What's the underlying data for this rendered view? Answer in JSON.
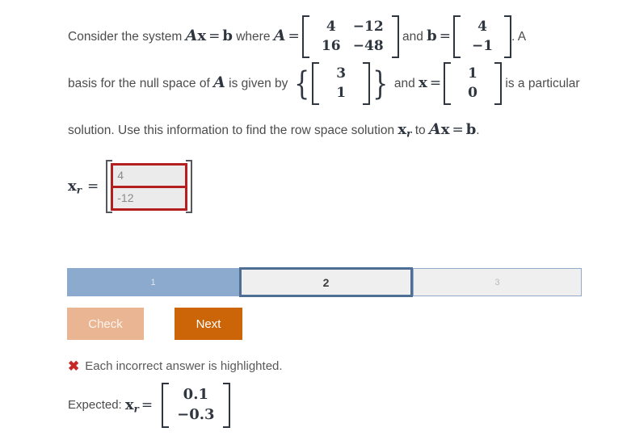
{
  "problem": {
    "line1_a": "Consider the system",
    "system_eq": {
      "A": "A",
      "x": "x",
      "eq": "=",
      "b": "b"
    },
    "line1_b": "where",
    "A_symbol": "A",
    "equals": "=",
    "matrix_A": {
      "rows": [
        [
          "4",
          "−12"
        ],
        [
          "16",
          "−48"
        ]
      ]
    },
    "line1_c": "and",
    "b_symbol": "b",
    "vector_b": {
      "rows": [
        [
          "4"
        ],
        [
          "−1"
        ]
      ]
    },
    "line1_d": ". A",
    "line2_a": "basis for the null space of",
    "line2_b": "is given by",
    "nullspace_basis": {
      "rows": [
        [
          "3"
        ],
        [
          "1"
        ]
      ]
    },
    "brace_open": "{",
    "brace_close": "}",
    "line2_c": "and",
    "x_symbol": "x",
    "vector_x": {
      "rows": [
        [
          "1"
        ],
        [
          "0"
        ]
      ]
    },
    "line2_d": "is a particular",
    "line3_a": "solution. Use this information to find the row space solution",
    "xr_symbol": "x",
    "xr_subscript": "r",
    "line3_b": "to",
    "line3_c": "."
  },
  "answer": {
    "label_symbol": "x",
    "label_subscript": "r",
    "equals": "=",
    "values": [
      "4",
      "-12"
    ],
    "state": "incorrect",
    "border_color": "#b41f1f",
    "field_background": "#ebebeb"
  },
  "steps": {
    "items": [
      {
        "label": "1",
        "state": "completed",
        "color": "#8caace"
      },
      {
        "label": "2",
        "state": "current",
        "color": "#4f6e94"
      },
      {
        "label": "3",
        "state": "upcoming",
        "color": "#efefef"
      }
    ]
  },
  "buttons": {
    "check_label": "Check",
    "check_color": "#eab593",
    "next_label": "Next",
    "next_color": "#cc6508"
  },
  "feedback": {
    "icon": "x-mark-icon",
    "icon_glyph": "✖",
    "icon_color": "#c62828",
    "message": "Each incorrect answer is highlighted.",
    "expected_label": "Expected:",
    "expected_symbol": "x",
    "expected_subscript": "r",
    "expected_equals": "=",
    "expected_values": [
      [
        "0.1"
      ],
      [
        "−0.3"
      ]
    ]
  }
}
